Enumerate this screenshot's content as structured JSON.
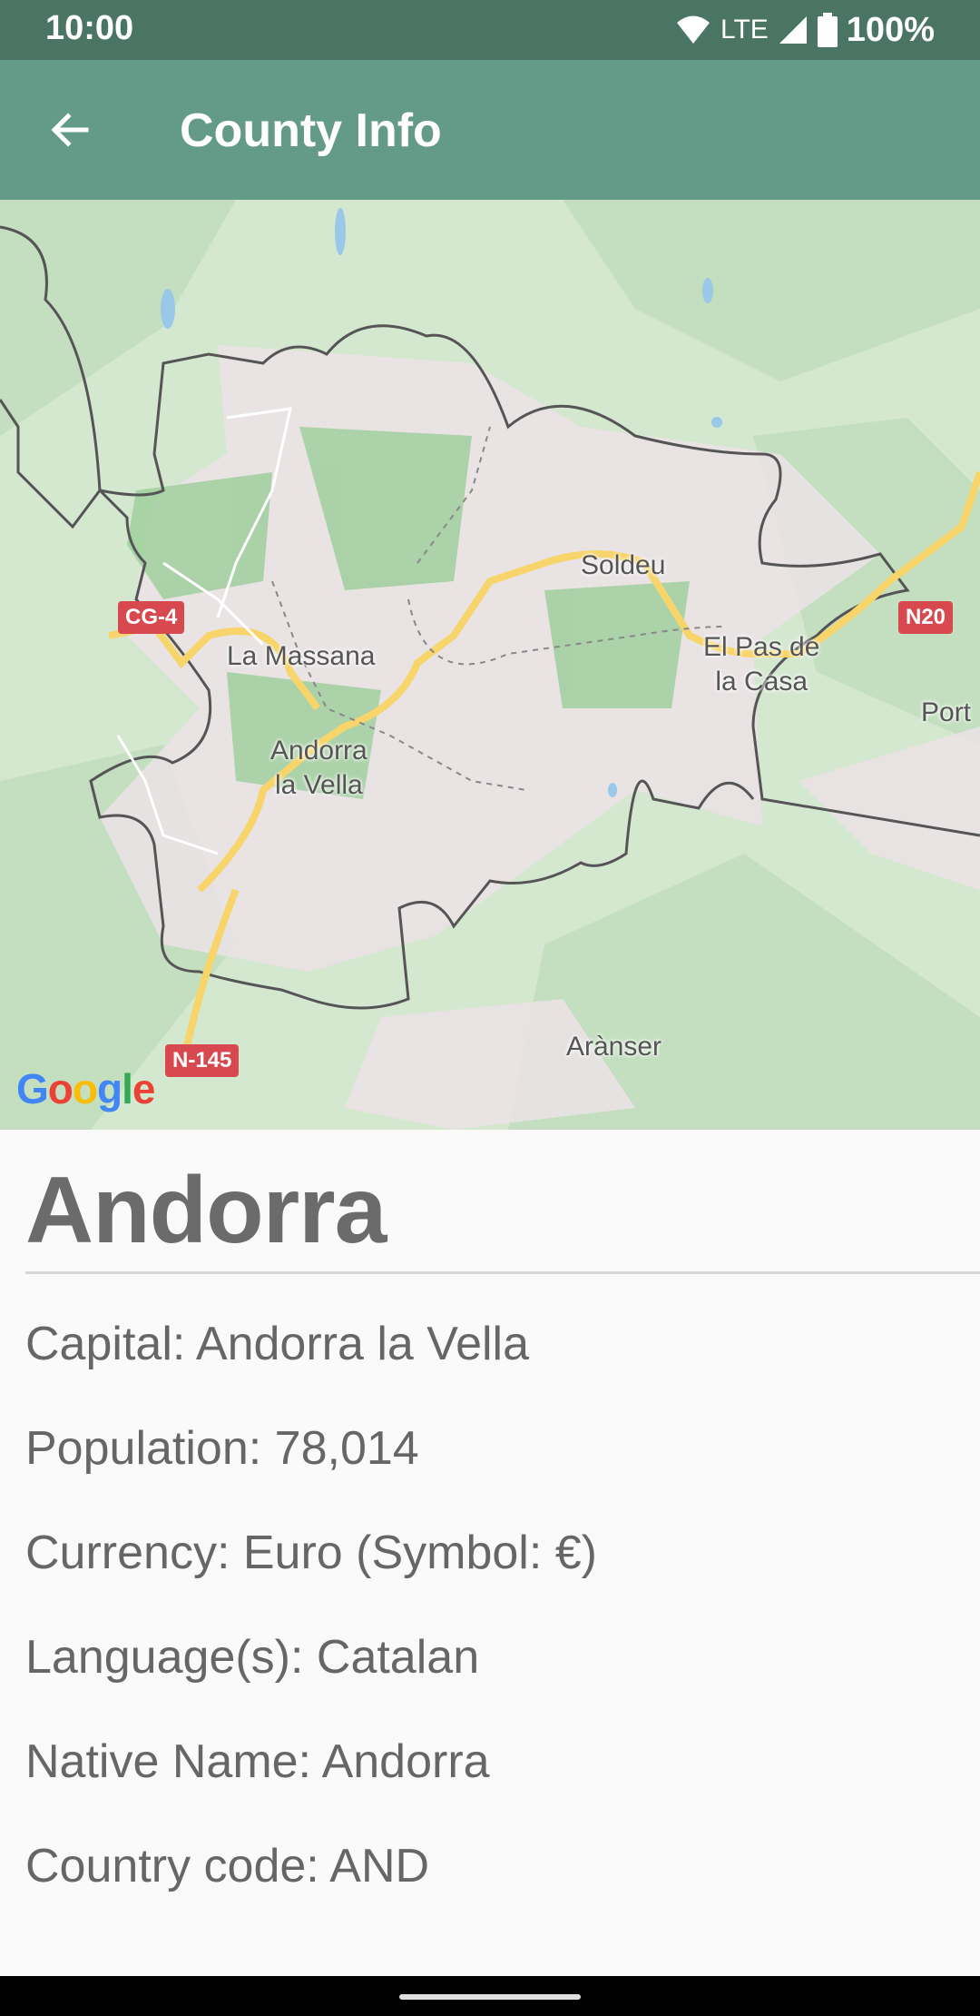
{
  "status": {
    "time": "10:00",
    "network": "LTE",
    "battery": "100%"
  },
  "app_bar": {
    "title": "County Info"
  },
  "map": {
    "labels": {
      "soldeu": "Soldeu",
      "la_massana": "La Massana",
      "el_pas_line1": "El Pas de",
      "el_pas_line2": "la Casa",
      "andorra_line1": "Andorra",
      "andorra_line2": "la Vella",
      "port": "Port",
      "aranser": "Arànser"
    },
    "road_shields": {
      "cg4": "CG-4",
      "n20": "N20",
      "n145": "N-145"
    },
    "attribution": {
      "g1": "G",
      "o1": "o",
      "o2": "o",
      "g2": "g",
      "l": "l",
      "e": "e"
    }
  },
  "country": {
    "name": "Andorra",
    "capital": "Capital: Andorra la Vella",
    "population": "Population: 78,014",
    "currency": "Currency: Euro (Symbol: €)",
    "languages": "Language(s): Catalan",
    "native_name": "Native Name: Andorra",
    "country_code": "Country code: AND"
  }
}
